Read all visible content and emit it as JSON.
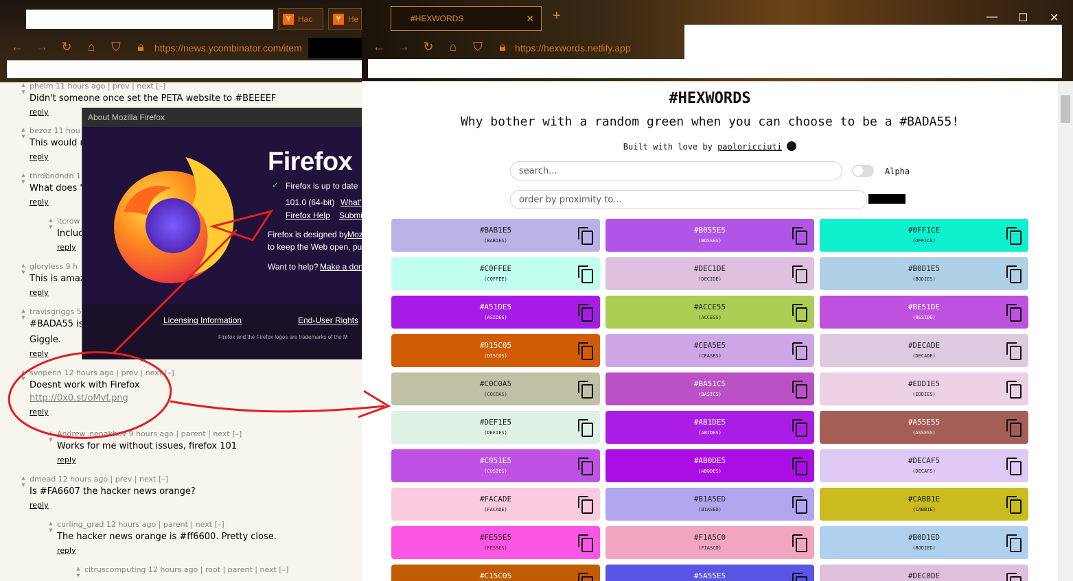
{
  "left_window": {
    "tabs": [
      {
        "label": "Hac"
      },
      {
        "label": "He"
      }
    ],
    "url": "https://news.ycombinator.com/item",
    "comments": [
      {
        "user": "phelm",
        "meta": "phelm 11 hours ago | prev | next [–]",
        "text": "Didn't someone once set the PETA website to #BEEEEF",
        "reply": "reply"
      },
      {
        "user": "bezoz",
        "meta": "bezoz 11 hou",
        "text": "This would r",
        "reply": "reply"
      },
      {
        "user": "thrdbndndn",
        "meta": "thrdbndndn 1",
        "text": "What does '",
        "reply": "reply"
      },
      {
        "user": "itcrow",
        "meta": "itcrow",
        "text": "Incluc",
        "reply": "reply"
      },
      {
        "user": "gloryless",
        "meta": "gloryless 9 h",
        "text": "This is amaz",
        "reply": "reply"
      },
      {
        "user": "travisgriggs",
        "meta": "travisgriggs 5",
        "text": "#BADA55 is",
        "text2": "Giggle.",
        "reply": "reply"
      },
      {
        "user": "svnpenn",
        "meta": "svnpenn 12 hours ago | prev | next [–]",
        "text": "Doesnt work with Firefox",
        "link": "http://0x0.st/oMvf.png",
        "reply": "reply"
      },
      {
        "user": "Andrew_nenakhov",
        "meta": "Andrew_nenakhov 9 hours ago | parent | next [–]",
        "text": "Works for me without issues, firefox 101",
        "reply": "reply"
      },
      {
        "user": "dmead",
        "meta": "dmead 12 hours ago | prev | next [–]",
        "text": "Is #FA6607 the hacker news orange?",
        "reply": "reply"
      },
      {
        "user": "curling_grad",
        "meta": "curling_grad 12 hours ago | parent | next [–]",
        "text": "The hacker news orange is #ff6600. Pretty close.",
        "reply": "reply"
      },
      {
        "user": "citruscomputing",
        "meta": "citruscomputing 12 hours ago | root | parent | next [–]"
      }
    ]
  },
  "about_dialog": {
    "title": "About Mozilla Firefox",
    "product": "Firefox",
    "status": "Firefox is up to date",
    "version": "101.0 (64-bit)",
    "whats_new": "What'",
    "help": "Firefox Help",
    "submit": "Submi",
    "designed_by": "Firefox is designed by",
    "designed_link": "Moz",
    "keep_web": "to keep the Web open, pu",
    "want_help": "Want to help?",
    "donate": "Make a don",
    "licensing": "Licensing Information",
    "eula": "End-User Rights",
    "trademark": "Firefox and the Firefox logos are trademarks of the M"
  },
  "right_window": {
    "tab_title": "#HEXWORDS",
    "url": "https://hexwords.netlify.app",
    "page": {
      "title": "#HEXWORDS",
      "subtitle": "Why bother with a random green when you can choose to be a #BADA55!",
      "built_prefix": "Built with love by",
      "author": "paoloricciuti",
      "search_placeholder": "search...",
      "alpha_label": "Alpha",
      "proximity_placeholder": "order by proximity to..."
    },
    "cards": [
      {
        "hex": "#BAB1E5",
        "word": "(BABIES)",
        "color": "#BAB1E5"
      },
      {
        "hex": "#B055E5",
        "word": "(BOSSES)",
        "color": "#B055E5"
      },
      {
        "hex": "#0FF1CE",
        "word": "(OFFICE)",
        "color": "#0FF1CE"
      },
      {
        "hex": "#C0FFEE",
        "word": "(COFFEE)",
        "color": "#C0FFEE"
      },
      {
        "hex": "#DEC1DE",
        "word": "(DECIDE)",
        "color": "#DEC1DE"
      },
      {
        "hex": "#B0D1E5",
        "word": "(BODIES)",
        "color": "#B0D1E5"
      },
      {
        "hex": "#A51DE5",
        "word": "(ASIDES)",
        "color": "#A51DE5"
      },
      {
        "hex": "#ACCE55",
        "word": "(ACCESS)",
        "color": "#ACCE55"
      },
      {
        "hex": "#BE51DE",
        "word": "(BESIDE)",
        "color": "#BE51DE"
      },
      {
        "hex": "#D15C05",
        "word": "(DISCOS)",
        "color": "#D15C05"
      },
      {
        "hex": "#CEA5E5",
        "word": "(CEASES)",
        "color": "#CEA5E5"
      },
      {
        "hex": "#DECADE",
        "word": "(DECADE)",
        "color": "#DECADE"
      },
      {
        "hex": "#C0C0A5",
        "word": "(COCOAS)",
        "color": "#C0C0A5"
      },
      {
        "hex": "#BA51C5",
        "word": "(BASICS)",
        "color": "#BA51C5"
      },
      {
        "hex": "#EDD1E5",
        "word": "(EDDIES)",
        "color": "#EDD1E5"
      },
      {
        "hex": "#DEF1E5",
        "word": "(DEFIES)",
        "color": "#DEF1E5"
      },
      {
        "hex": "#AB1DE5",
        "word": "(ABIDES)",
        "color": "#AB1DE5"
      },
      {
        "hex": "#A55E55",
        "word": "(ASSESS)",
        "color": "#A55E55"
      },
      {
        "hex": "#C051E5",
        "word": "(COSIES)",
        "color": "#C051E5"
      },
      {
        "hex": "#AB0DE5",
        "word": "(ABODES)",
        "color": "#AB0DE5"
      },
      {
        "hex": "#DECAF5",
        "word": "(DECAFS)",
        "color": "#DECAF5"
      },
      {
        "hex": "#FACADE",
        "word": "(FACADE)",
        "color": "#FACADE"
      },
      {
        "hex": "#B1A5ED",
        "word": "(BIASED)",
        "color": "#B1A5ED"
      },
      {
        "hex": "#CABB1E",
        "word": "(CABBIE)",
        "color": "#CABB1E"
      },
      {
        "hex": "#FE55E5",
        "word": "(FESSES)",
        "color": "#FE55E5"
      },
      {
        "hex": "#F1A5C0",
        "word": "(FIASCO)",
        "color": "#F1A5C0"
      },
      {
        "hex": "#B0D1ED",
        "word": "(BODIED)",
        "color": "#B0D1ED"
      },
      {
        "hex": "#C15C05",
        "word": "",
        "color": "#C15C05"
      },
      {
        "hex": "#5A55E5",
        "word": "",
        "color": "#5A55E5"
      },
      {
        "hex": "#DEC0DE",
        "word": "",
        "color": "#DEC0DE"
      }
    ]
  },
  "colors": {
    "accent_orange": "#E07A10",
    "annotation_red": "#E02020",
    "hn_bg": "#F6F6EF",
    "firefox_dialog_bg": "#20123A"
  }
}
